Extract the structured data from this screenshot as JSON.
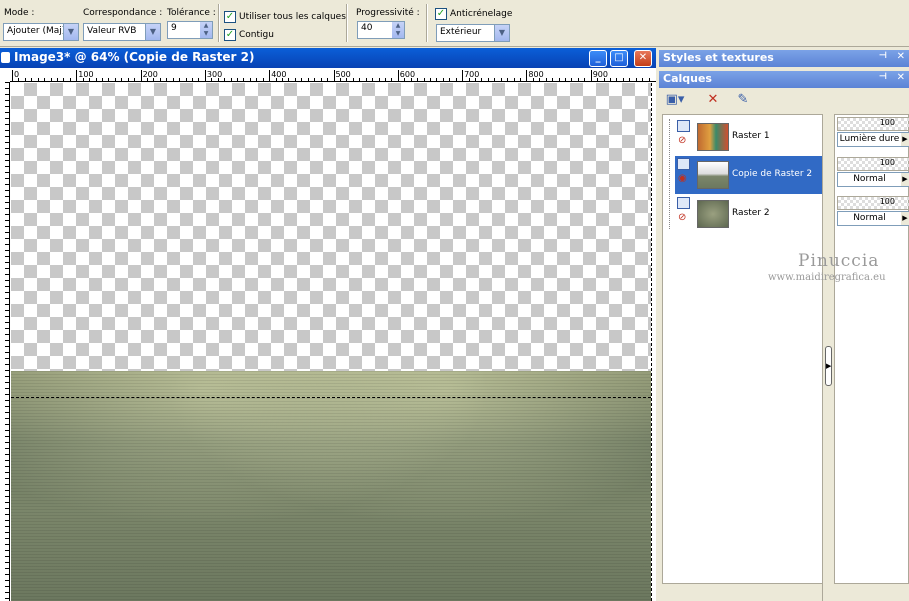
{
  "toolbar": {
    "mode_label": "Mode :",
    "mode_value": "Ajouter (Maj)",
    "match_label": "Correspondance :",
    "match_value": "Valeur RVB",
    "tolerance_label": "Tolérance :",
    "tolerance_value": "9",
    "use_all_layers_label": "Utiliser tous les calques",
    "use_all_layers_checked": true,
    "contiguous_label": "Contigu",
    "contiguous_checked": true,
    "feather_label": "Progressivité :",
    "feather_value": "40",
    "antialias_label": "Anticrénelage",
    "antialias_checked": true,
    "antialias_mode": "Extérieur"
  },
  "image_window": {
    "title": "Image3* @  64% (Copie de Raster 2)",
    "ruler_ticks": [
      "0",
      "100",
      "200",
      "300",
      "400",
      "500",
      "600",
      "700",
      "800",
      "900"
    ]
  },
  "panels": {
    "styles_title": "Styles et textures",
    "layers_title": "Calques",
    "layers": [
      {
        "name": "Raster 1",
        "opacity": "100",
        "blend": "Lumière dure",
        "selected": false
      },
      {
        "name": "Copie de Raster 2",
        "opacity": "100",
        "blend": "Normal",
        "selected": true
      },
      {
        "name": "Raster 2",
        "opacity": "100",
        "blend": "Normal",
        "selected": false
      }
    ]
  },
  "watermark": {
    "line1": "Pinuccia",
    "line2": "www.maidiregrafica.eu"
  },
  "colors": {
    "title_bar": "#0a5fd8",
    "selection": "#316ac5",
    "floor": "#7b866a"
  }
}
